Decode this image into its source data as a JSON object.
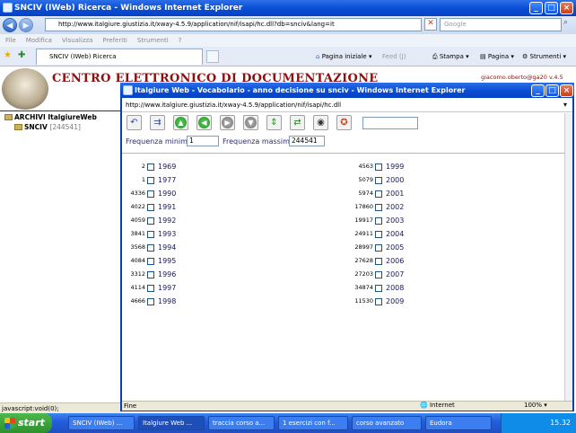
{
  "browser": {
    "title": "SNCIV (IWeb) Ricerca - Windows Internet Explorer",
    "address": "http://www.italgiure.giustizia.it/xway-4.5.9/application/nif/isapi/hc.dll?db=snciv&lang=it",
    "search_placeholder": "Google"
  },
  "menu": [
    "File",
    "Modifica",
    "Visualizza",
    "Preferiti",
    "Strumenti",
    "?"
  ],
  "tab": "SNCIV (IWeb) Ricerca",
  "commands": {
    "home": "Pagina iniziale",
    "feed": "Feed (J)",
    "print": "Stampa",
    "page": "Pagina",
    "tools": "Strumenti"
  },
  "page": {
    "header": "CENTRO ELETTRONICO DI DOCUMENTAZIONE",
    "user": "giacomo.oberto@ga20",
    "version": "v.4.5",
    "tree_root": "ARCHIVI ItalgiureWeb",
    "tree_db": "SNCIV",
    "tree_db_count": "[244541]",
    "status": "javascript:void(0);"
  },
  "popup": {
    "title": "Italgiure Web - Vocabolario - anno decisione su snciv - Windows Internet Explorer",
    "address": "http://www.italgiure.giustizia.it/xway-4.5.9/application/nif/isapi/hc.dll",
    "freq_min_label": "Frequenza minima",
    "freq_min": "1",
    "freq_max_label": "Frequenza massima",
    "freq_max": "244541",
    "left": [
      {
        "c": "2",
        "y": "1969"
      },
      {
        "c": "1",
        "y": "1977"
      },
      {
        "c": "4336",
        "y": "1990"
      },
      {
        "c": "4022",
        "y": "1991"
      },
      {
        "c": "4059",
        "y": "1992"
      },
      {
        "c": "3841",
        "y": "1993"
      },
      {
        "c": "3568",
        "y": "1994"
      },
      {
        "c": "4084",
        "y": "1995"
      },
      {
        "c": "3312",
        "y": "1996"
      },
      {
        "c": "4114",
        "y": "1997"
      },
      {
        "c": "4666",
        "y": "1998"
      }
    ],
    "right": [
      {
        "c": "4563",
        "y": "1999"
      },
      {
        "c": "5079",
        "y": "2000"
      },
      {
        "c": "5974",
        "y": "2001"
      },
      {
        "c": "17860",
        "y": "2002"
      },
      {
        "c": "19917",
        "y": "2003"
      },
      {
        "c": "24911",
        "y": "2004"
      },
      {
        "c": "28997",
        "y": "2005"
      },
      {
        "c": "27628",
        "y": "2006"
      },
      {
        "c": "27203",
        "y": "2007"
      },
      {
        "c": "34874",
        "y": "2008"
      },
      {
        "c": "11530",
        "y": "2009"
      }
    ],
    "status_left": "Fine",
    "status_zone": "Internet",
    "zoom": "100%"
  },
  "taskbar": {
    "start": "start",
    "items": [
      "SNCIV (IWeb) ...",
      "Italgiure Web ...",
      "traccia corso a...",
      "1 esercizi con f...",
      "corso avanzato",
      "Eudora"
    ],
    "lang": "IT",
    "clock": "15.32"
  }
}
